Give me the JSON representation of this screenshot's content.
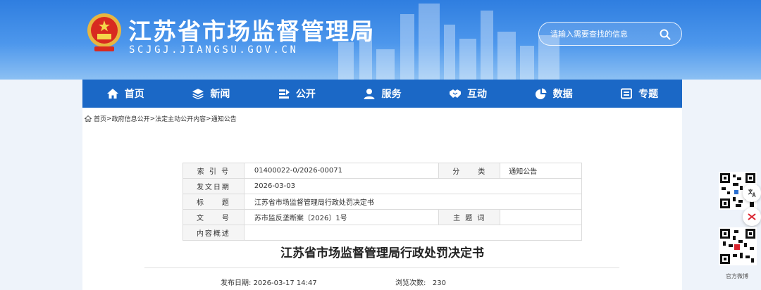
{
  "header": {
    "title": "江苏省市场监督管理局",
    "domain": "SCJGJ.JIANGSU.GOV.CN",
    "search_placeholder": "请输入需要查找的信息"
  },
  "nav": [
    {
      "label": "首页",
      "icon": "home-icon"
    },
    {
      "label": "新闻",
      "icon": "layers-icon"
    },
    {
      "label": "公开",
      "icon": "open-icon"
    },
    {
      "label": "服务",
      "icon": "user-icon"
    },
    {
      "label": "互动",
      "icon": "handshake-icon"
    },
    {
      "label": "数据",
      "icon": "pie-chart-icon"
    },
    {
      "label": "专题",
      "icon": "monitor-icon"
    }
  ],
  "breadcrumb": {
    "items": [
      "首页",
      "政府信息公开",
      "法定主动公开内容",
      "通知公告"
    ],
    "separator": ">"
  },
  "meta": {
    "index_label": "索 引 号",
    "index_value": "01400022-0/2026-00071",
    "category_label": "分　　类",
    "category_value": "通知公告",
    "date_label": "发文日期",
    "date_value": "2026-03-03",
    "subject_label": "标　　题",
    "subject_value": "江苏省市场监督管理局行政处罚决定书",
    "docno_label": "文　　号",
    "docno_value": "苏市监反垄断案〔2026〕1号",
    "keyword_label": "主 题 词",
    "keyword_value": "",
    "summary_label": "内容概述",
    "summary_value": ""
  },
  "article": {
    "title": "江苏省市场监督管理局行政处罚决定书",
    "publish_label": "发布日期:",
    "publish_date": "2026-03-17 14:47",
    "views_label": "浏览次数:",
    "views_count": "230"
  },
  "side": {
    "qr1_label": "",
    "qr2_label": "官方微博"
  },
  "colors": {
    "nav_bg": "#1b68c6",
    "banner_top": "#2f7ee0",
    "banner_bottom": "#8cc0f3",
    "page_bg": "#eef3fa"
  }
}
